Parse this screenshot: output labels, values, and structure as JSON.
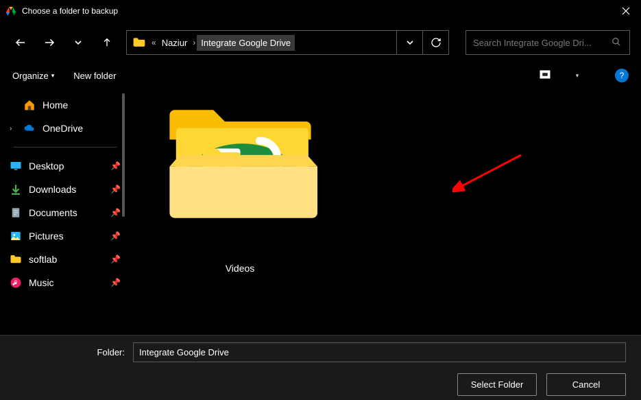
{
  "title": "Choose a folder to backup",
  "breadcrumb": {
    "ellipsis": "«",
    "segments": [
      "Naziur",
      "Integrate Google Drive"
    ]
  },
  "search": {
    "placeholder": "Search Integrate Google Dri..."
  },
  "toolbar": {
    "organize": "Organize",
    "newfolder": "New folder"
  },
  "sidebar": {
    "home": "Home",
    "onedrive": "OneDrive",
    "quick": [
      {
        "label": "Desktop"
      },
      {
        "label": "Downloads"
      },
      {
        "label": "Documents"
      },
      {
        "label": "Pictures"
      },
      {
        "label": "softlab"
      },
      {
        "label": "Music"
      }
    ]
  },
  "content": {
    "items": [
      {
        "name": "Videos"
      }
    ]
  },
  "footer": {
    "folder_label": "Folder:",
    "folder_value": "Integrate Google Drive",
    "select": "Select Folder",
    "cancel": "Cancel"
  },
  "help": "?"
}
